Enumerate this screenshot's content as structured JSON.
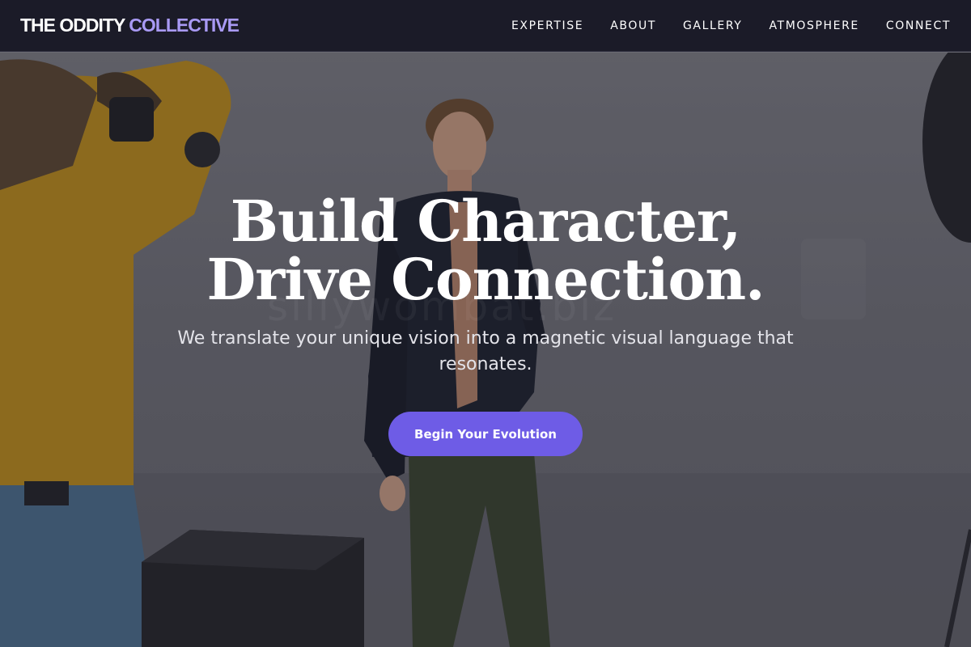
{
  "brand": {
    "main": "THE ODDITY ",
    "accent": "COLLECTIVE"
  },
  "nav": {
    "links": [
      {
        "label": "EXPERTISE"
      },
      {
        "label": "ABOUT"
      },
      {
        "label": "GALLERY"
      },
      {
        "label": "ATMOSPHERE"
      },
      {
        "label": "CONNECT"
      }
    ]
  },
  "hero": {
    "headline_line1": "Build Character,",
    "headline_line2": "Drive Connection.",
    "subheadline": "We translate your unique vision into a magnetic visual language that resonates.",
    "cta_label": "Begin Your Evolution",
    "watermark": "sillywombat.biz"
  },
  "colors": {
    "nav_bg": "#1b1b28",
    "brand_accent": "#a99af5",
    "cta_bg": "#6e5ce6"
  }
}
